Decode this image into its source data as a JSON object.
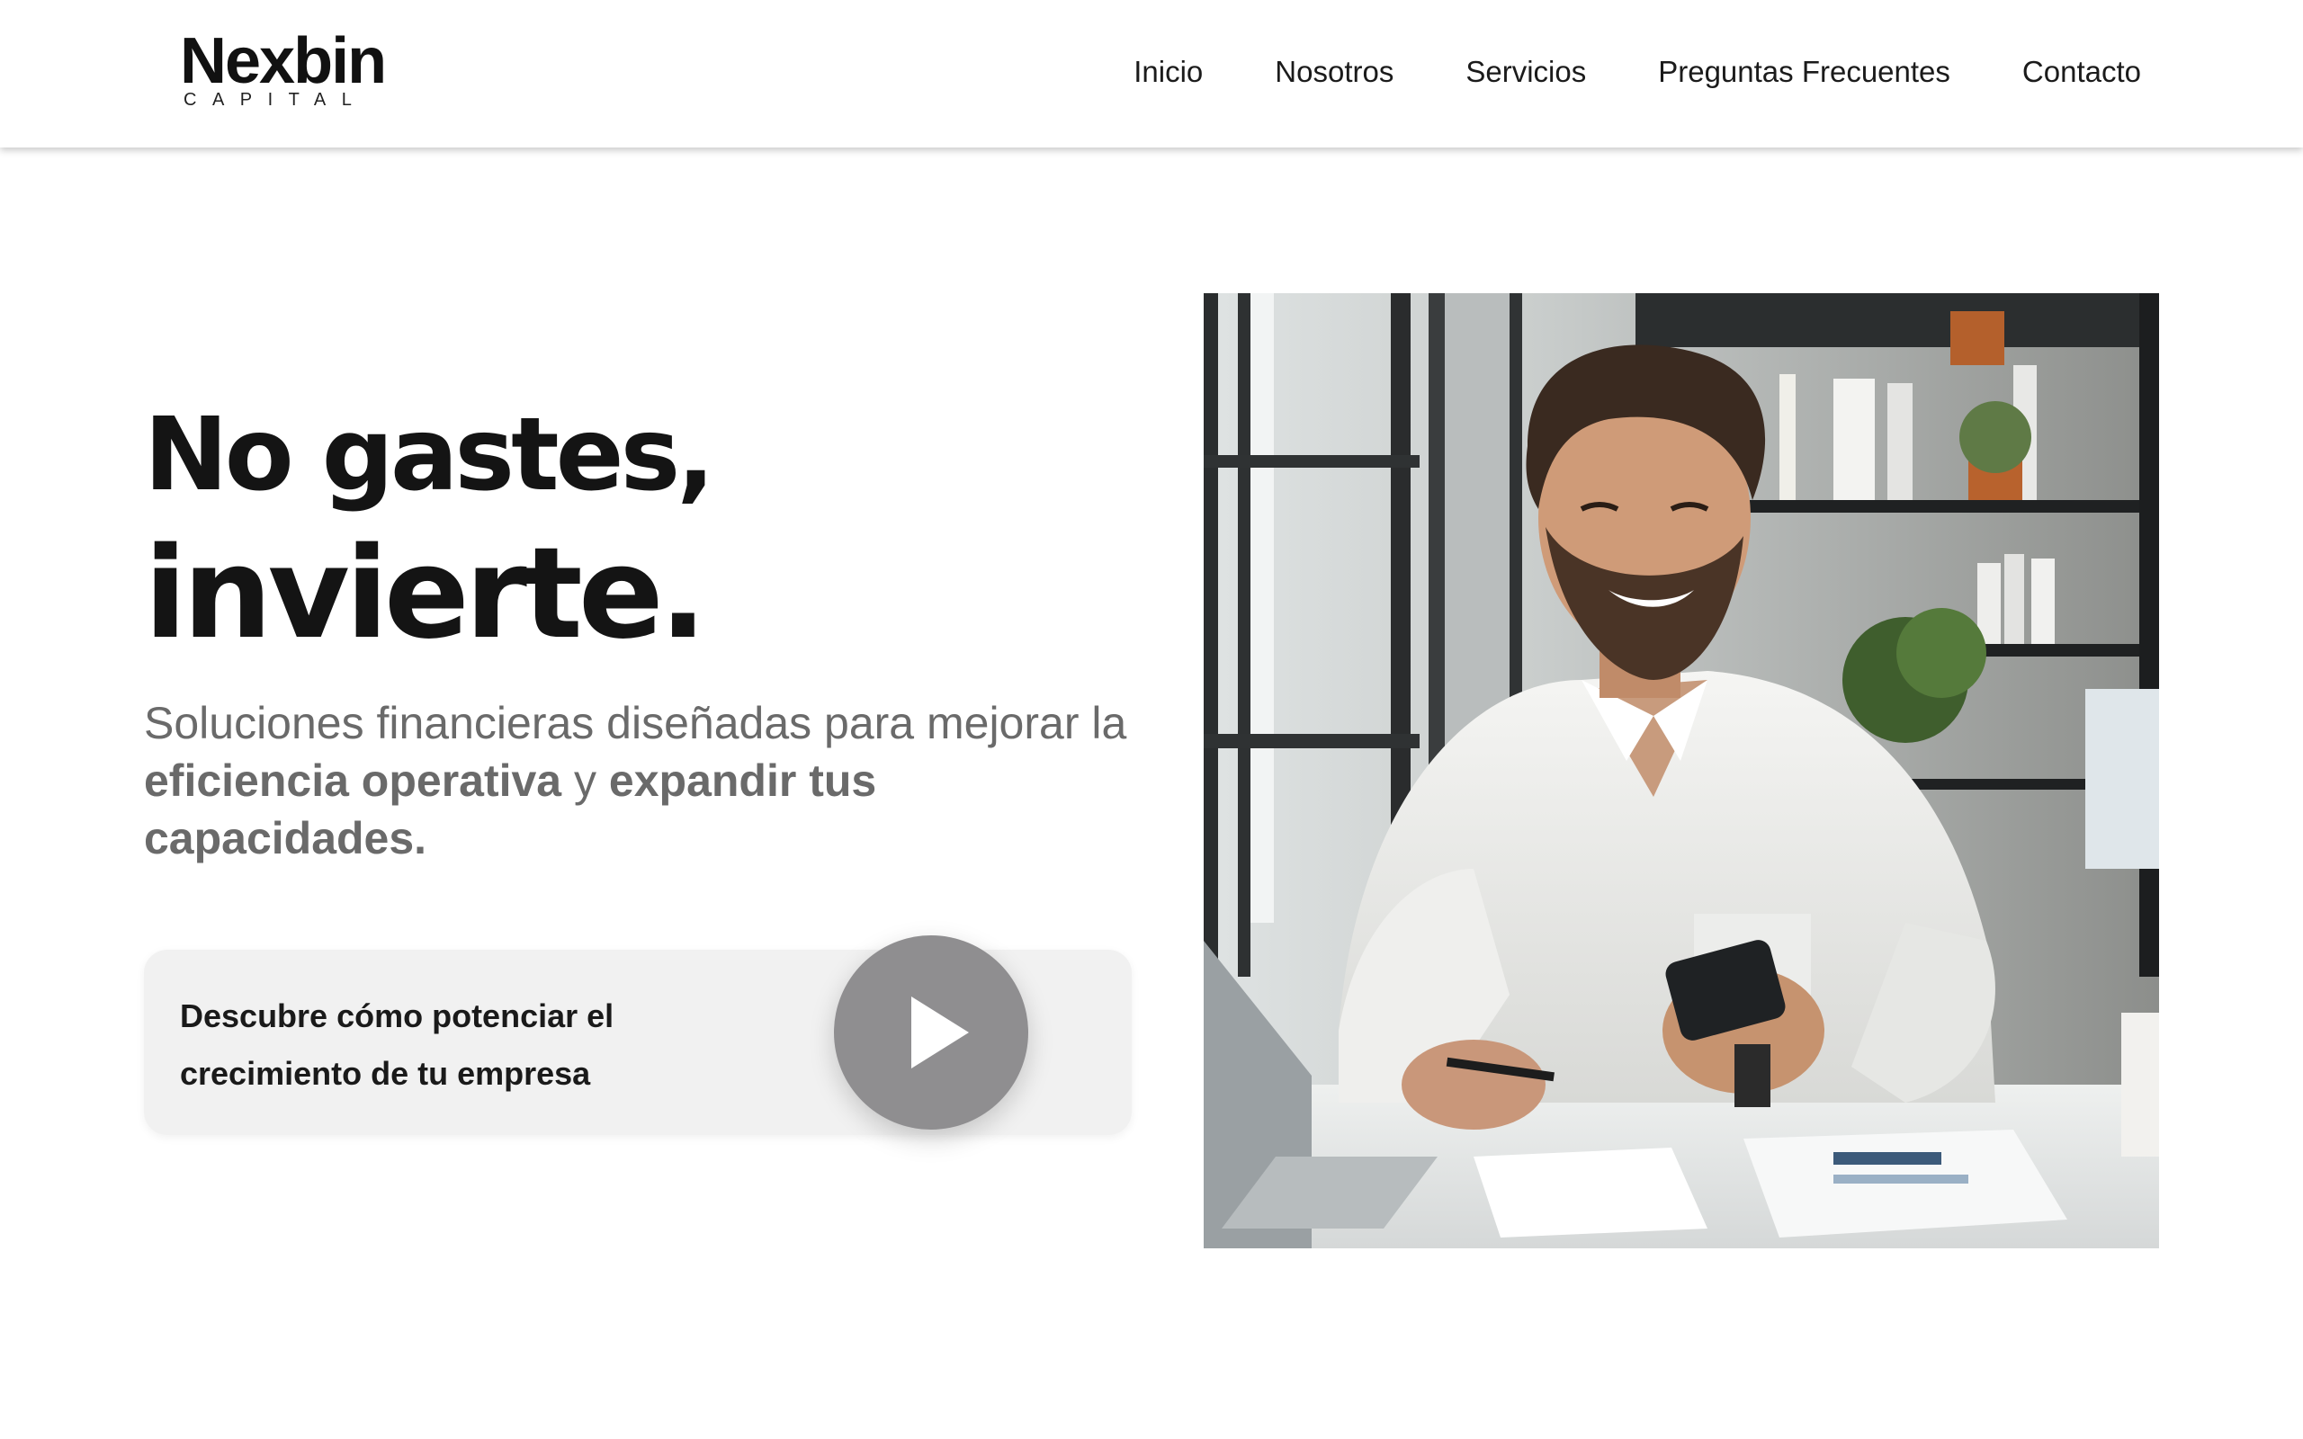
{
  "brand": {
    "name": "Nexbin",
    "tagline": "CAPITAL"
  },
  "nav": {
    "items": [
      {
        "label": "Inicio"
      },
      {
        "label": "Nosotros"
      },
      {
        "label": "Servicios"
      },
      {
        "label": "Preguntas Frecuentes"
      },
      {
        "label": "Contacto"
      }
    ]
  },
  "hero": {
    "headline_line1": "No gastes,",
    "headline_line2": "invierte.",
    "subhead": {
      "part1": "Soluciones financieras diseñadas para mejorar la ",
      "bold1": "eficiencia operativa",
      "part2": " y ",
      "bold2": "expandir tus capacidades."
    },
    "cta": {
      "text": "Descubre cómo potenciar el crecimiento de tu empresa",
      "icon": "play-icon"
    },
    "image": {
      "icon": "photo-man-with-phone"
    }
  },
  "colors": {
    "text": "#141414",
    "muted": "#6a6a6a",
    "card": "#f1f1f1",
    "play": "#8f8e90"
  }
}
